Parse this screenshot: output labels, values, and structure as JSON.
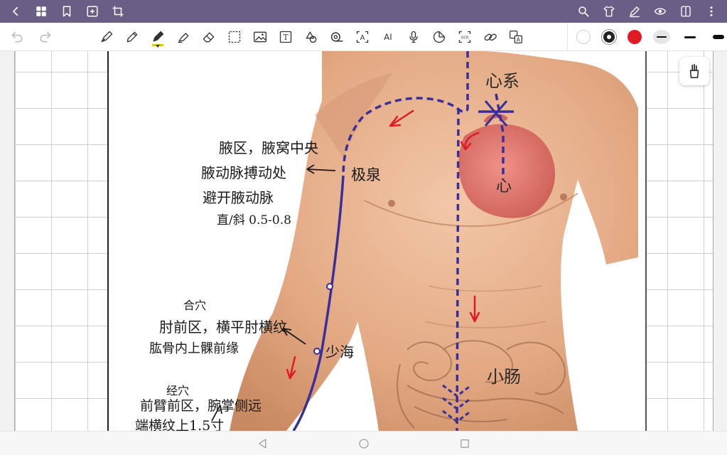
{
  "colors": {
    "topbar": "#6a5d86",
    "ink_red": "#e01b24",
    "ink_blue": "#3a2f9a",
    "highlighter_yellow": "#e8c200"
  },
  "topbar": {
    "left_icons": [
      "back-icon",
      "grid-icon",
      "bookmark-icon",
      "add-page-icon",
      "crop-icon"
    ],
    "right_icons": [
      "search-icon",
      "shirt-icon",
      "pen-edit-icon",
      "eye-icon",
      "page-view-icon",
      "more-icon"
    ]
  },
  "toolbar": {
    "undo_icons": [
      "undo-icon",
      "redo-icon"
    ],
    "tools": [
      {
        "icon": "fountain-pen-icon"
      },
      {
        "icon": "pencil-icon"
      },
      {
        "icon": "marker-icon",
        "active": true
      },
      {
        "icon": "highlighter-icon"
      },
      {
        "icon": "eraser-icon"
      },
      {
        "icon": "lasso-select-icon"
      },
      {
        "icon": "image-icon"
      },
      {
        "icon": "text-box-icon",
        "text": "T"
      },
      {
        "icon": "shape-icon"
      },
      {
        "icon": "tape-icon"
      },
      {
        "icon": "text-recognize-icon",
        "text": "A"
      },
      {
        "icon": "ai-icon",
        "text": "AI"
      },
      {
        "icon": "microphone-icon"
      },
      {
        "icon": "sticker-icon"
      },
      {
        "icon": "ocr-icon",
        "text": "OCR"
      },
      {
        "icon": "link-icon"
      },
      {
        "icon": "translate-icon",
        "text": "A"
      }
    ],
    "palette": {
      "colors": [
        "#ffffff",
        "#222222",
        "#e01b24"
      ],
      "selected_color": "#222222",
      "stroke_widths": [
        "thin",
        "medium",
        "thick"
      ],
      "selected_stroke": "thin"
    }
  },
  "annotations": {
    "heart_meridian": "心系",
    "heart": "心",
    "small_intestine": "小肠",
    "jiquan": "极泉",
    "jiquan_desc_1": "腋区，腋窝中央",
    "jiquan_desc_2": "腋动脉搏动处",
    "jiquan_desc_3": "避开腋动脉",
    "jiquan_desc_4": "直/斜 0.5-0.8",
    "shaohai": "少海",
    "shaohai_type": "合穴",
    "shaohai_desc_1": "肘前区，横平肘横纹",
    "shaohai_desc_2": "肱骨内上髁前缘",
    "lingdao_type": "经穴",
    "lingdao_desc_1": "前臂前区，腕掌侧远",
    "lingdao_desc_2": "端横纹上1.5寸"
  },
  "navbar": {
    "icons": [
      "nav-back-icon",
      "nav-home-icon",
      "nav-recents-icon"
    ]
  }
}
